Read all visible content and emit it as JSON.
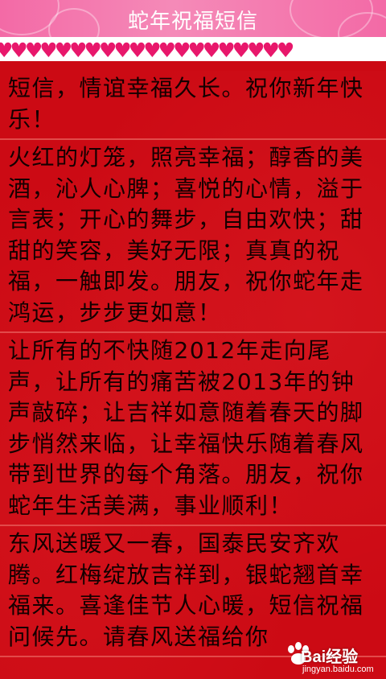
{
  "header": {
    "title": "蛇年祝福短信",
    "heart_icon": "heart-icon"
  },
  "messages": [
    "短信，情谊幸福久长。祝你新年快乐！",
    "火红的灯笼，照亮幸福；醇香的美酒，沁人心脾；喜悦的心情，溢于言表；开心的舞步，自由欢快；甜甜的笑容，美好无限；真真的祝福，一触即发。朋友，祝你蛇年走鸿运，步步更如意！",
    "让所有的不快随2012年走向尾声，让所有的痛苦被2013年的钟声敲碎；让吉祥如意随着春天的脚步悄然来临，让幸福快乐随着春风带到世界的每个角落。朋友，祝你蛇年生活美满，事业顺利！",
    "东风送暖又一春，国泰民安齐欢腾。红梅绽放吉祥到，银蛇翘首幸福来。喜逢佳节人心暖，短信祝福问候先。请春风送福给你"
  ],
  "watermark": {
    "brand": "Bai经验",
    "url": "jingyan.baidu.com",
    "icon": "paw-icon"
  },
  "colors": {
    "background": "#cc0a14",
    "header_pink": "#f36aa6",
    "heart_pink": "#e8176b",
    "divider": "#e24a4a",
    "text": "#140000"
  }
}
